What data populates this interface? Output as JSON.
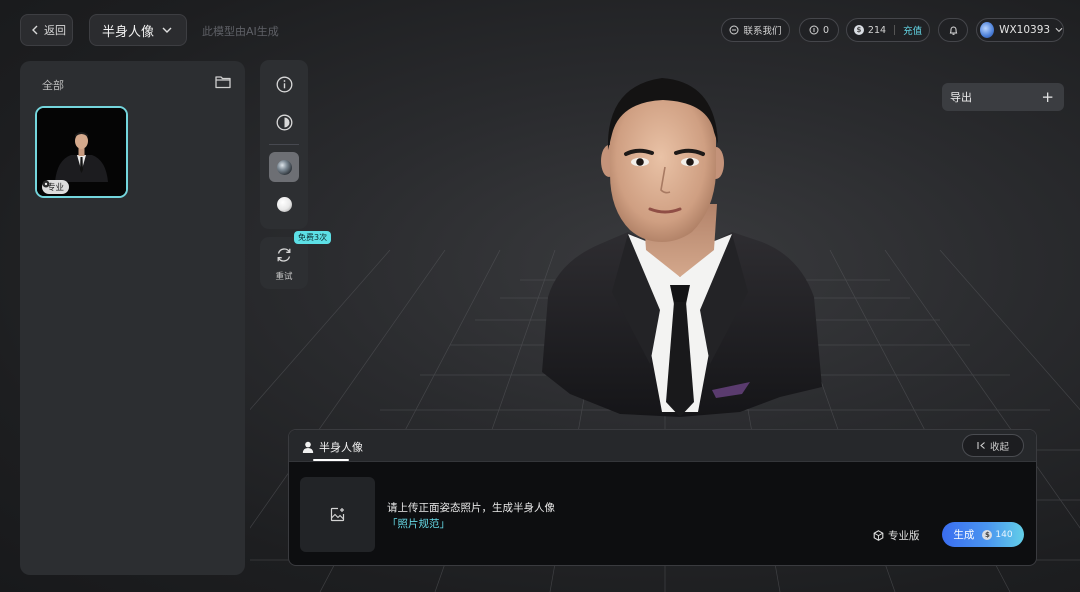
{
  "topbar": {
    "back_label": "返回",
    "model_name": "半身人像",
    "model_note": "此模型由AI生成",
    "contact_label": "联系我们",
    "coupon_count": "0",
    "points": "214",
    "recharge_label": "充值",
    "username": "WX10393"
  },
  "left_panel": {
    "title": "全部",
    "items": [
      {
        "badge": "专业"
      }
    ]
  },
  "tools": {
    "retry_label": "重试",
    "free_badge": "免费3次"
  },
  "export": {
    "label": "导出",
    "plus": "+"
  },
  "bottom_panel": {
    "tab_label": "半身人像",
    "collapse_label": "收起",
    "upload_hint": "请上传正面姿态照片，生成半身人像",
    "spec_link": "「照片规范」",
    "pro_label": "专业版",
    "generate_label": "生成",
    "generate_cost": "140"
  },
  "colors": {
    "accent_cyan": "#64d8e8",
    "generate_gradient_start": "#3a6df0",
    "generate_gradient_end": "#63cfe8",
    "thumbnail_border": "#74d6dd"
  },
  "icons": {
    "back": "chevron-left-icon",
    "dropdown": "chevron-down-icon",
    "contact": "chat-bubble-icon",
    "coupon": "coupon-icon",
    "points": "coin-icon",
    "bell": "bell-icon",
    "folder": "folder-icon",
    "info": "info-icon",
    "contrast": "contrast-icon",
    "environment": "environment-sphere-icon",
    "white_material": "white-sphere-icon",
    "retry": "refresh-icon",
    "person": "person-icon",
    "collapse": "collapse-panel-icon",
    "upload": "image-add-icon",
    "pro": "hexagon-icon"
  }
}
